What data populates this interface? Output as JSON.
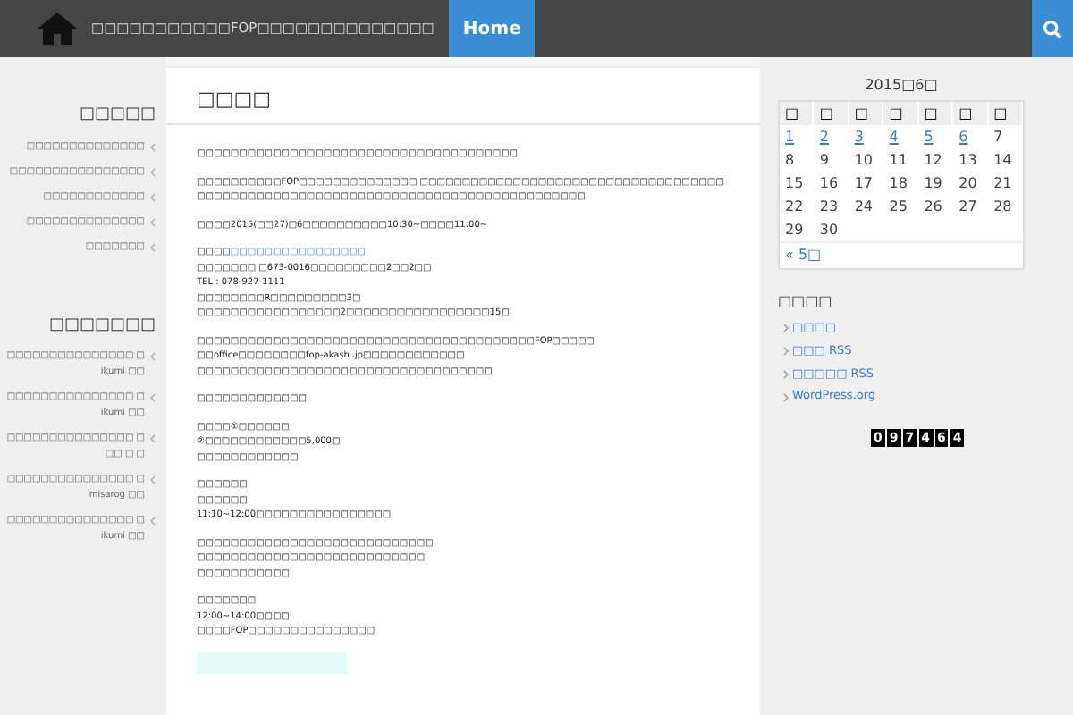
{
  "header": {
    "site_title": "□□□□□□□□□□□FOP□□□□□□□□□□□□□□",
    "nav": [
      {
        "label": "Home",
        "selected": true
      }
    ]
  },
  "left_sidebar": [
    {
      "title": "□□□□□",
      "items": [
        "□□□□□□□□□□□□□□",
        "□□□□□□□□□□□□□□□□",
        "□□□□□□□□□□□□",
        "□□□□□□□□□□□□□□",
        "□□□□□□□"
      ]
    },
    {
      "title": "□□□□□□□",
      "items": [
        "□□□□□□□□□□□□□□□ □ ikumi □□",
        "□□□□□□□□□□□□□□□ □ ikumi □□",
        "□□□□□□□□□□□□□□□ □ □□ □ □",
        "□□□□□□□□□□□□□□□ □ misarog □□",
        "□□□□□□□□□□□□□□□ □ ikumi □□"
      ]
    }
  ],
  "article": {
    "title": "□□□□",
    "paragraphs": [
      [
        "□□□□□□□□□□□□□□□□□□□□□□□□□□□□□□□□□□□□□□"
      ],
      [
        "□□□□□□□□□□FOP□□□□□□□□□□□□□□ □□□□□□□□□□□□□□□□□□□□□□□□□□□□□□□□□□□□□□□□□□□□□□□□□□□□□□□□□□□□□□□□□□□□□□□□□□□□□□□□□□"
      ],
      [
        "□□□□2015(□□27)□6□□□□□□□□□□10:30~□□□□11:00~"
      ],
      [
        {
          "kind": "link",
          "prefix": "□□□□",
          "link": "□□□□□□□□□□□□□□□□"
        },
        "□□□□□□□ □673-0016□□□□□□□□□2□□2□□",
        "TEL : 078-927-1111",
        "□□□□□□□□R□□□□□□□□□3□",
        "□□□□□□□□□□□□□□□□□2□□□□□□□□□□□□□□□□□15□"
      ],
      [
        "□□□□□□□□□□□□□□□□□□□□□□□□□□□□□□□□□□□□□□□□FOP□□□□□",
        "□□office□□□□□□□□fop-akashi.jp□□□□□□□□□□□□",
        "□□□□□□□□□□□□□□□□□□□□□□□□□□□□□□□□□□□"
      ],
      [
        "□□□□□□□□□□□□□"
      ],
      [
        "□□□□①□□□□□□",
        "②□□□□□□□□□□□□5,000□",
        "□□□□□□□□□□□□"
      ],
      [
        "□□□□□□",
        "□□□□□□",
        "11:10~12:00□□□□□□□□□□□□□□□□"
      ],
      [
        "□□□□□□□□□□□□□□□□□□□□□□□□□□□□",
        "□□□□□□□□□□□□□□□□□□□□□□□□□□□",
        "□□□□□□□□□□□"
      ],
      [
        "□□□□□□□",
        "12:00~14:00□□□□",
        "□□□□FOP□□□□□□□□□□□□□□□"
      ]
    ]
  },
  "calendar": {
    "caption": "2015□6□",
    "weekdays": [
      "□",
      "□",
      "□",
      "□",
      "□",
      "□",
      "□"
    ],
    "weeks": [
      [
        {
          "day": "1",
          "linked": true
        },
        {
          "day": "2",
          "linked": true
        },
        {
          "day": "3",
          "linked": true
        },
        {
          "day": "4",
          "linked": true
        },
        {
          "day": "5",
          "linked": true
        },
        {
          "day": "6",
          "linked": true
        },
        {
          "day": "7",
          "linked": false
        }
      ],
      [
        {
          "day": "8",
          "linked": false
        },
        {
          "day": "9",
          "linked": false
        },
        {
          "day": "10",
          "linked": false
        },
        {
          "day": "11",
          "linked": false
        },
        {
          "day": "12",
          "linked": false
        },
        {
          "day": "13",
          "linked": false
        },
        {
          "day": "14",
          "linked": false
        }
      ],
      [
        {
          "day": "15",
          "linked": false
        },
        {
          "day": "16",
          "linked": false
        },
        {
          "day": "17",
          "linked": false
        },
        {
          "day": "18",
          "linked": false
        },
        {
          "day": "19",
          "linked": false
        },
        {
          "day": "20",
          "linked": false
        },
        {
          "day": "21",
          "linked": false
        }
      ],
      [
        {
          "day": "22",
          "linked": false
        },
        {
          "day": "23",
          "linked": false
        },
        {
          "day": "24",
          "linked": false
        },
        {
          "day": "25",
          "linked": false
        },
        {
          "day": "26",
          "linked": false
        },
        {
          "day": "27",
          "linked": false
        },
        {
          "day": "28",
          "linked": false
        }
      ],
      [
        {
          "day": "29",
          "linked": false
        },
        {
          "day": "30",
          "linked": false
        }
      ]
    ],
    "prev_link": "« 5□"
  },
  "meta": {
    "title": "□□□□",
    "links": [
      "□□□□",
      "□□□ RSS",
      "□□□□□ RSS",
      "WordPress.org"
    ]
  },
  "counter": [
    "0",
    "9",
    "7",
    "4",
    "6",
    "4"
  ]
}
